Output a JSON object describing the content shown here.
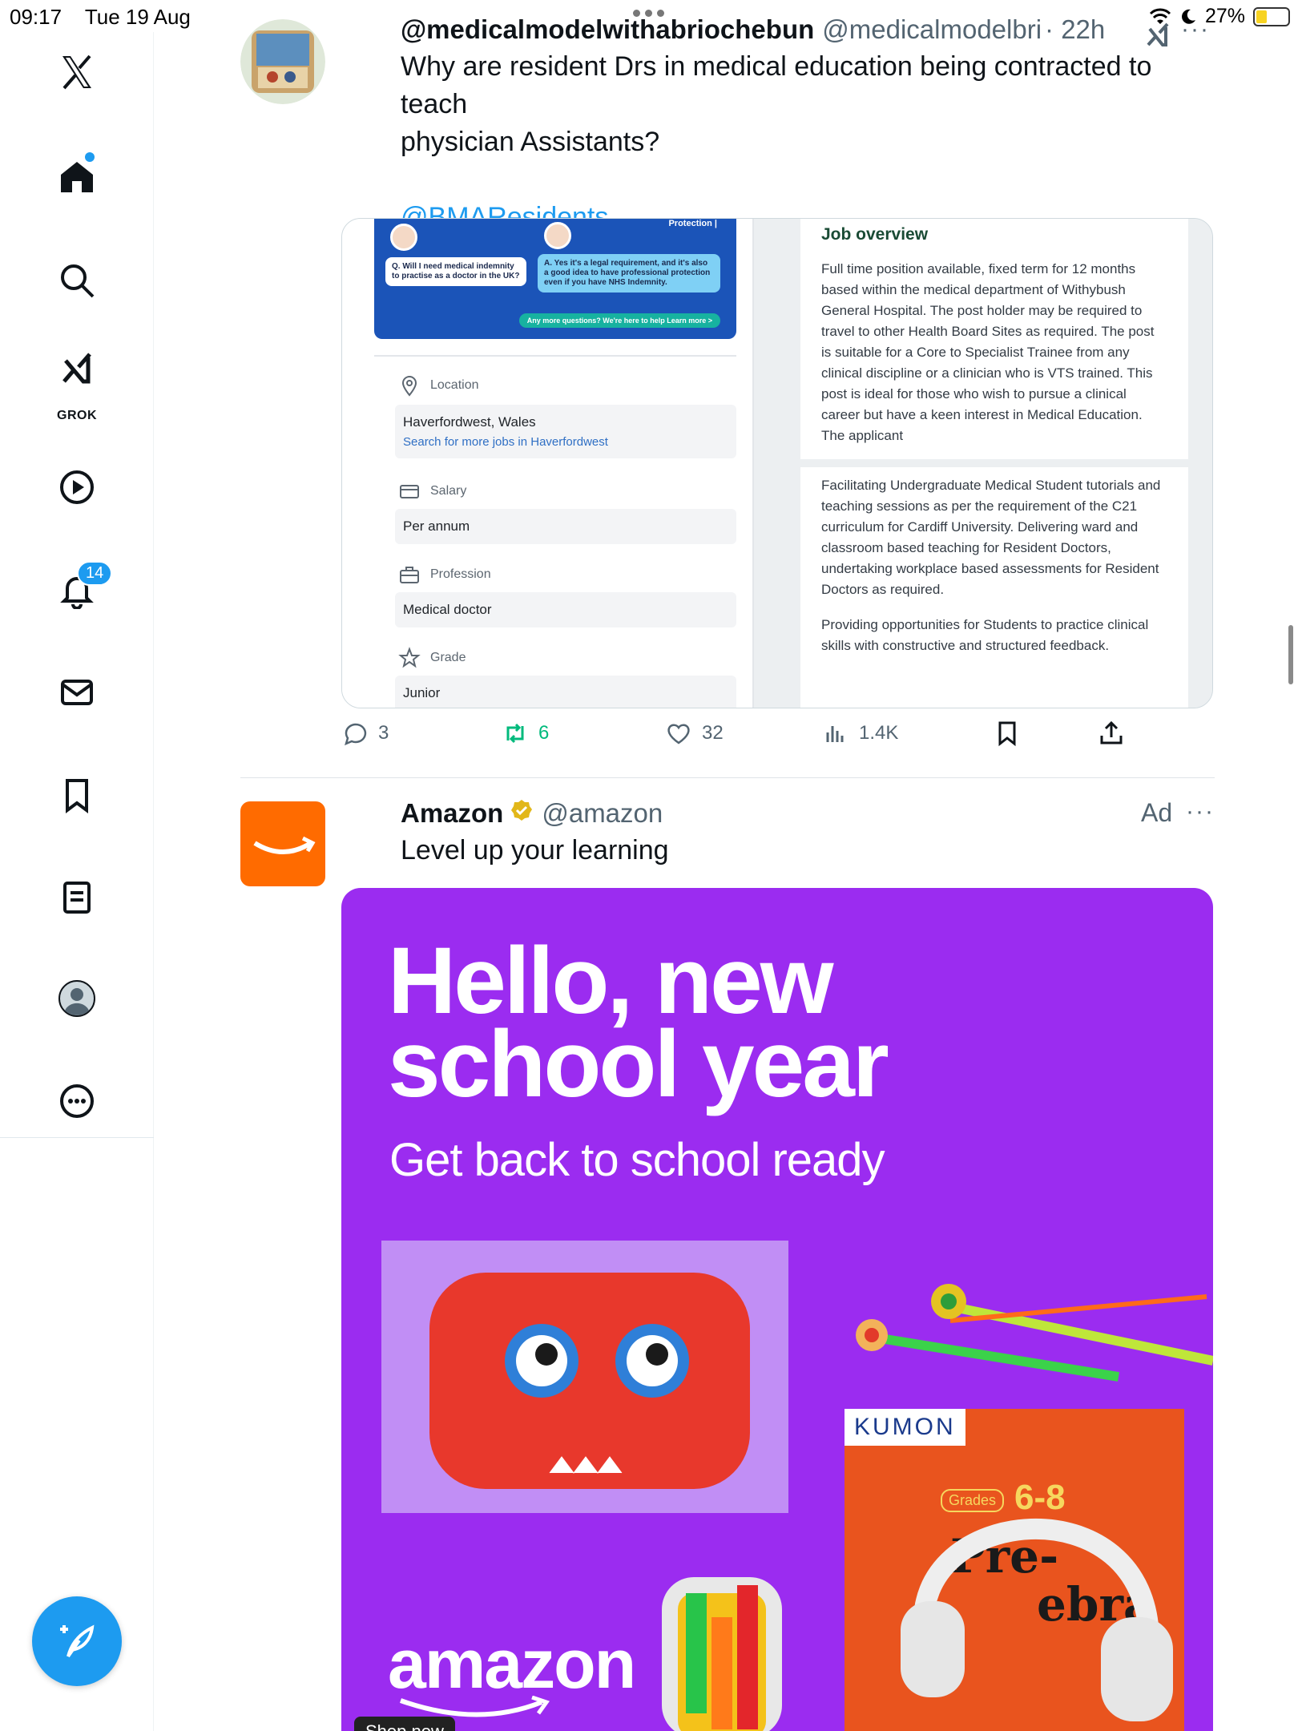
{
  "status": {
    "time": "09:17",
    "date": "Tue 19 Aug",
    "battery": "27%"
  },
  "sidebar": {
    "grok_label": "GROK",
    "notifications_count": "14"
  },
  "post1": {
    "author": "@medicalmodelwithabriochebun",
    "handle": "@medicalmodelbri",
    "time": "· 22h",
    "text_line1": "Why are resident Drs in medical education being contracted to teach",
    "text_line2": "physician Assistants?",
    "mention": "@BMAResidents",
    "media": {
      "banner_protection": "Protection |",
      "banner_question": "Q. Will I need medical indemnity to practise as a doctor in the UK?",
      "banner_answer": "A. Yes it's a legal requirement, and it's also a good idea to have professional protection even if you have NHS Indemnity.",
      "banner_cta": "Any more questions? We're here to help  Learn more >",
      "location_label": "Location",
      "location_value": "Haverfordwest, Wales",
      "location_link": "Search for more jobs in Haverfordwest",
      "salary_label": "Salary",
      "salary_value": "Per annum",
      "profession_label": "Profession",
      "profession_value": "Medical doctor",
      "grade_label": "Grade",
      "grade_value": "Junior",
      "job_title": "Job overview",
      "job_para1": "Full time position available, fixed term for 12 months based within the medical department of Withybush General Hospital. The post holder may be required to travel to other Health Board Sites as required.      The post is suitable for a Core to Specialist Trainee from any clinical discipline or a clinician who is VTS trained.  This post is ideal for those who wish to pursue a clinical career but have a keen interest in Medical Education.  The applicant",
      "job_para2": "Facilitating Undergraduate Medical Student tutorials and teaching sessions as per the requirement of the C21 curriculum for Cardiff University.      Delivering ward and classroom based teaching for Resident Doctors, undertaking workplace based assessments for Resident Doctors as required.",
      "job_para3": "Providing opportunities for Students to practice clinical skills with constructive and structured feedback."
    },
    "actions": {
      "replies": "3",
      "reposts": "6",
      "likes": "32",
      "views": "1.4K"
    }
  },
  "ad": {
    "author": "Amazon",
    "handle": "@amazon",
    "label": "Ad",
    "text": "Level up your learning",
    "headline_line1": "Hello, new",
    "headline_line2": "school year",
    "subline": "Get back to school ready",
    "brand": "amazon",
    "kumon": "KUMON",
    "grades": "Grades",
    "grade_range": "6-8",
    "book_title1": "Pre-",
    "book_title2": "ebra",
    "shop_now": "Shop now"
  },
  "colors": {
    "accent": "#1d9bf0",
    "repost_green": "#00ba7c",
    "ad_purple": "#9b2cf0",
    "amazon_orange": "#ff6b00"
  }
}
